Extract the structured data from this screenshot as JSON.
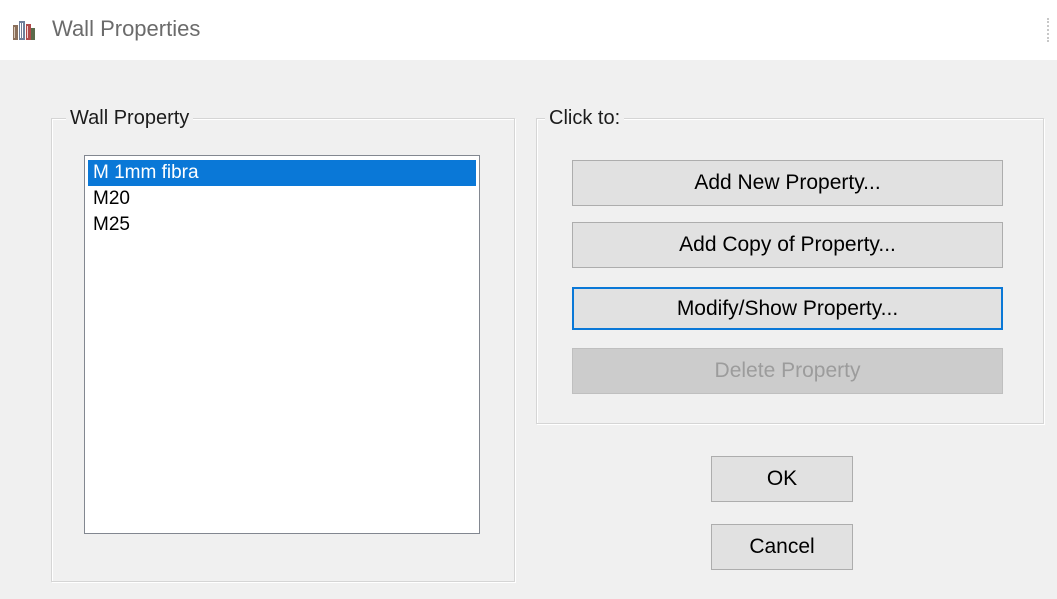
{
  "window": {
    "title": "Wall Properties",
    "icon": "building-icon"
  },
  "wall_property_group": {
    "label": "Wall Property",
    "items": [
      {
        "label": "M 1mm fibra",
        "selected": true
      },
      {
        "label": "M20",
        "selected": false
      },
      {
        "label": "M25",
        "selected": false
      }
    ]
  },
  "click_to_group": {
    "label": "Click to:",
    "add_new_label": "Add New Property...",
    "add_copy_label": "Add Copy of Property...",
    "modify_show_label": "Modify/Show Property...",
    "delete_label": "Delete Property"
  },
  "dialog_buttons": {
    "ok_label": "OK",
    "cancel_label": "Cancel"
  },
  "colors": {
    "selection": "#0a78d7",
    "focus_border": "#0a78d7",
    "button_face": "#e1e1e1",
    "disabled_face": "#cccccc",
    "disabled_text": "#9c9c9c",
    "dialog_background": "#f0f0f0"
  }
}
